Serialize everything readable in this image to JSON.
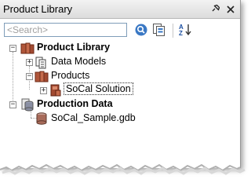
{
  "window": {
    "title": "Product Library"
  },
  "search": {
    "placeholder": "<Search>"
  },
  "toolbar": {
    "buttons": [
      {
        "icon": "search-icon"
      },
      {
        "icon": "catalog-view-icon"
      },
      {
        "icon": "sort-az-icon"
      }
    ]
  },
  "tree": {
    "product_library": "Product Library",
    "data_models": "Data Models",
    "products": "Products",
    "socal_solution": "SoCal Solution",
    "production_data": "Production Data",
    "socal_sample": "SoCal_Sample.gdb"
  },
  "colors": {
    "titlebar": "#dcdcdc",
    "library_icon": "#b0563a",
    "database_icon": "#8a8fa3",
    "accent": "#2e6fb5"
  }
}
